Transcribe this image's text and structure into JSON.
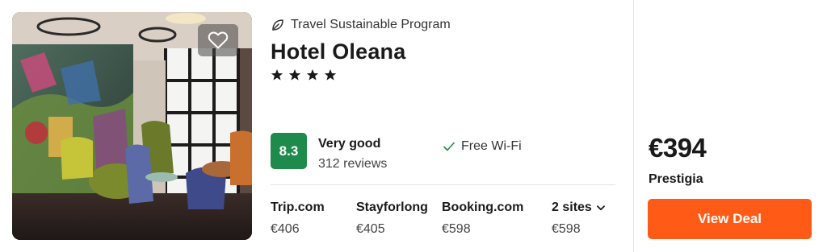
{
  "colors": {
    "score_badge": "#1e8a4c",
    "deal_button": "#ff5b16",
    "text_primary": "#1a1a1a",
    "text_secondary": "#444444"
  },
  "hotel": {
    "sustainability_label": "Travel Sustainable Program",
    "name": "Hotel Oleana",
    "star_count": 4,
    "star_glyph": "★",
    "favorite_icon": "heart-outline-icon"
  },
  "rating": {
    "score": "8.3",
    "label": "Very good",
    "reviews": "312 reviews"
  },
  "amenities": [
    {
      "icon": "check-icon",
      "label": "Free Wi-Fi"
    }
  ],
  "providers": [
    {
      "name": "Trip.com",
      "price": "€406"
    },
    {
      "name": "Stayforlong",
      "price": "€405"
    },
    {
      "name": "Booking.com",
      "price": "€598"
    },
    {
      "name": "2 sites",
      "price": "€598",
      "dropdown": true
    }
  ],
  "best_deal": {
    "price": "€394",
    "provider": "Prestigia",
    "button_label": "View Deal"
  }
}
